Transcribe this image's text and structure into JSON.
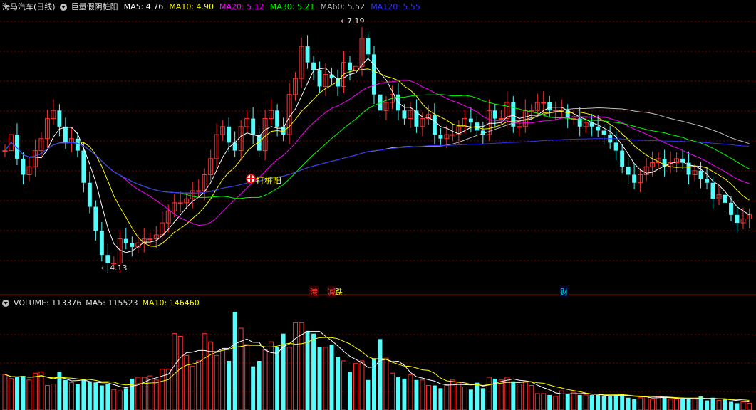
{
  "header": {
    "stock": "海马汽车(日线)",
    "indicator": "巨量假阴桩阳",
    "ma": [
      {
        "label": "MA5: 4.76",
        "color": "#ffffff"
      },
      {
        "label": "MA10: 4.90",
        "color": "#ffff00"
      },
      {
        "label": "MA20: 5.12",
        "color": "#ff00ff"
      },
      {
        "label": "MA30: 5.21",
        "color": "#00ff00"
      },
      {
        "label": "MA60: 5.52",
        "color": "#c0c0c0"
      },
      {
        "label": "MA120: 5.55",
        "color": "#3030ff"
      }
    ]
  },
  "volume_header": {
    "label": "VOLUME: 113376",
    "ma5": "MA5: 115523",
    "ma10": "MA10: 146460"
  },
  "annotations": {
    "high": "7.19",
    "low": "4.13",
    "signal": "打桩阳"
  },
  "event_markers": [
    {
      "text": "港",
      "color": "#ff4040"
    },
    {
      "text": "减",
      "color": "#ff4040"
    },
    {
      "text": "跌",
      "color": "#ffff00"
    },
    {
      "text": "财",
      "color": "#00ffff"
    }
  ],
  "colors": {
    "up": "#ff3232",
    "down": "#54fcfc",
    "ma5": "#ffffff",
    "ma10": "#ffff00",
    "ma20": "#ff00ff",
    "ma30": "#00ff00",
    "ma60": "#c0c0c0",
    "ma120": "#3030ff",
    "grid": "#800000"
  },
  "chart_data": {
    "type": "candlestick",
    "price_range": [
      4.0,
      7.3
    ],
    "close": [
      5.6,
      5.8,
      5.5,
      5.3,
      5.4,
      5.6,
      5.75,
      6.0,
      6.1,
      5.9,
      5.7,
      5.75,
      5.6,
      5.2,
      4.9,
      4.6,
      4.3,
      4.2,
      4.2,
      4.5,
      4.45,
      4.4,
      4.45,
      4.5,
      4.5,
      4.55,
      4.7,
      4.85,
      4.95,
      4.95,
      5.0,
      5.1,
      5.1,
      5.3,
      5.5,
      5.8,
      5.9,
      5.7,
      5.6,
      5.9,
      6.0,
      5.8,
      5.6,
      6.0,
      6.1,
      5.9,
      5.8,
      6.3,
      6.5,
      6.9,
      6.7,
      6.6,
      6.4,
      6.55,
      6.5,
      6.4,
      6.7,
      6.6,
      6.65,
      7.0,
      6.8,
      6.3,
      6.1,
      6.2,
      6.3,
      6.1,
      6.0,
      6.1,
      5.9,
      6.0,
      6.05,
      5.8,
      5.75,
      5.8,
      5.8,
      5.9,
      6.0,
      5.95,
      5.85,
      5.8,
      6.1,
      6.0,
      6.0,
      6.2,
      5.9,
      5.9,
      6.1,
      6.1,
      6.2,
      6.2,
      6.1,
      6.1,
      6.1,
      6.0,
      6.0,
      5.9,
      5.95,
      5.9,
      5.85,
      5.8,
      5.7,
      5.6,
      5.4,
      5.3,
      5.2,
      5.3,
      5.4,
      5.45,
      5.5,
      5.4,
      5.45,
      5.5,
      5.45,
      5.3,
      5.35,
      5.25,
      5.2,
      5.0,
      5.05,
      4.95,
      4.8,
      4.7,
      4.75,
      4.8
    ],
    "volume": [
      130000,
      115000,
      120000,
      125000,
      110000,
      135000,
      140000,
      90000,
      95000,
      140000,
      110000,
      100000,
      95000,
      110000,
      105000,
      100000,
      90000,
      95000,
      75000,
      70000,
      80000,
      115000,
      120000,
      120000,
      125000,
      110000,
      150000,
      150000,
      280000,
      270000,
      200000,
      160000,
      180000,
      280000,
      250000,
      200000,
      220000,
      180000,
      360000,
      300000,
      240000,
      160000,
      180000,
      220000,
      250000,
      230000,
      280000,
      230000,
      320000,
      320000,
      290000,
      280000,
      230000,
      230000,
      240000,
      195000,
      180000,
      140000,
      170000,
      180000,
      110000,
      190000,
      260000,
      190000,
      135000,
      120000,
      115000,
      130000,
      110000,
      110000,
      90000,
      90000,
      80000,
      90000,
      110000,
      100000,
      85000,
      75000,
      100000,
      80000,
      120000,
      115000,
      110000,
      120000,
      105000,
      95000,
      105000,
      90000,
      60000,
      60000,
      55000,
      50000,
      70000,
      60000,
      65000,
      55000,
      55000,
      55000,
      55000,
      50000,
      50000,
      55000,
      60000,
      45000,
      40000,
      45000,
      50000,
      40000,
      50000,
      45000,
      40000,
      40000,
      45000,
      40000,
      40000,
      50000,
      35000,
      45000,
      35000,
      40000,
      30000,
      25000,
      30000,
      25000
    ],
    "ma_last": {
      "MA5": 4.76,
      "MA10": 4.9,
      "MA20": 5.12,
      "MA30": 5.21,
      "MA60": 5.52,
      "MA120": 5.55
    },
    "volume_ma_last": {
      "MA5": 115523,
      "MA10": 146460
    },
    "high_marker": 7.19,
    "low_marker": 4.13
  }
}
